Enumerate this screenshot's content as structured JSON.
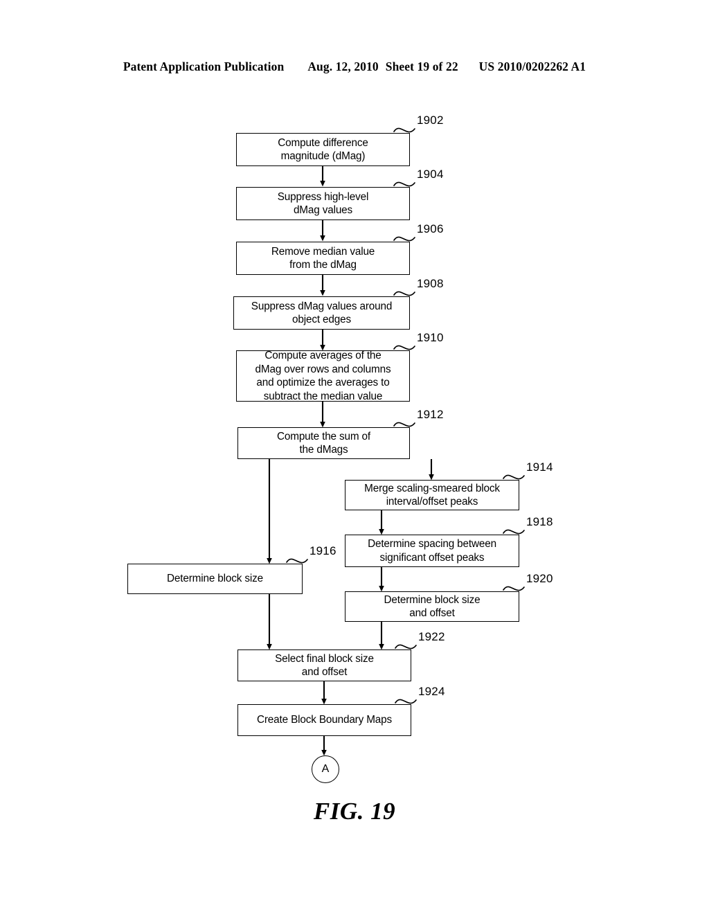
{
  "header": {
    "publication_label": "Patent Application Publication",
    "date": "Aug. 12, 2010",
    "sheet": "Sheet 19 of 22",
    "patent_number": "US 2010/0202262 A1"
  },
  "figure": {
    "caption": "FIG. 19",
    "connector_label": "A"
  },
  "boxes": [
    {
      "ref": "1902",
      "text": "Compute difference\nmagnitude (dMag)"
    },
    {
      "ref": "1904",
      "text": "Suppress high-level\ndMag values"
    },
    {
      "ref": "1906",
      "text": "Remove median value\nfrom the dMag"
    },
    {
      "ref": "1908",
      "text": "Suppress dMag values around\nobject edges"
    },
    {
      "ref": "1910",
      "text": "Compute averages of the\ndMag over rows and columns\nand optimize the averages to\nsubtract the median value"
    },
    {
      "ref": "1912",
      "text": "Compute the sum of\nthe dMags"
    },
    {
      "ref": "1914",
      "text": "Merge scaling-smeared block\ninterval/offset peaks"
    },
    {
      "ref": "1916",
      "text": "Determine block size"
    },
    {
      "ref": "1918",
      "text": "Determine spacing between\nsignificant offset peaks"
    },
    {
      "ref": "1920",
      "text": "Determine block size\nand offset"
    },
    {
      "ref": "1922",
      "text": "Select final block size\nand offset"
    },
    {
      "ref": "1924",
      "text": "Create Block Boundary Maps"
    }
  ]
}
